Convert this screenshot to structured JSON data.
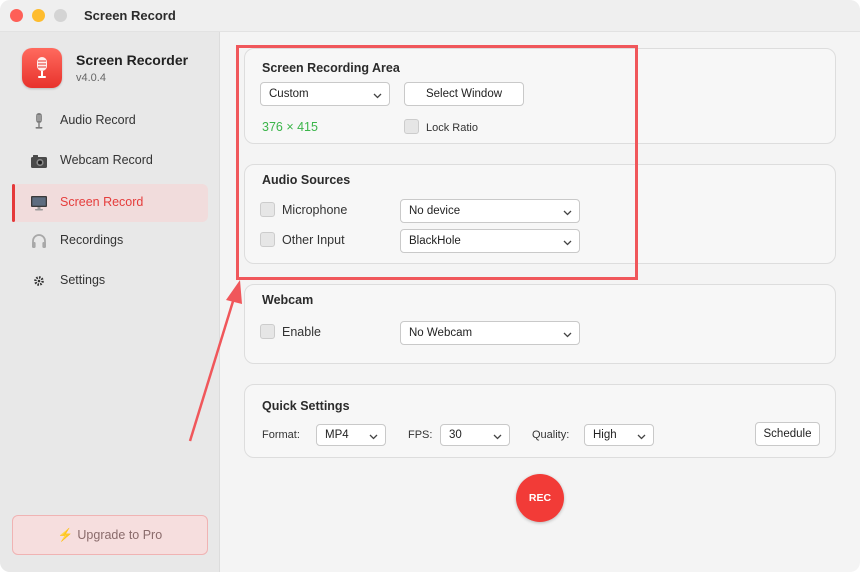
{
  "window": {
    "title": "Screen Record"
  },
  "app": {
    "name": "Screen Recorder",
    "version": "v4.0.4"
  },
  "sidebar": {
    "items": [
      {
        "label": "Audio Record",
        "icon": "microphone-icon"
      },
      {
        "label": "Webcam Record",
        "icon": "webcam-icon"
      },
      {
        "label": "Screen Record",
        "icon": "monitor-icon",
        "active": true
      },
      {
        "label": "Recordings",
        "icon": "headphones-icon"
      },
      {
        "label": "Settings",
        "icon": "gear-icon"
      }
    ],
    "upgrade_label": "Upgrade to Pro"
  },
  "recording_area": {
    "title": "Screen Recording Area",
    "mode_value": "Custom",
    "select_window_label": "Select Window",
    "dimensions": "376 × 415",
    "lock_ratio_label": "Lock Ratio",
    "lock_ratio_checked": false
  },
  "audio_sources": {
    "title": "Audio Sources",
    "microphone_label": "Microphone",
    "microphone_device": "No device",
    "other_input_label": "Other Input",
    "other_input_device": "BlackHole"
  },
  "webcam": {
    "title": "Webcam",
    "enable_label": "Enable",
    "device": "No Webcam"
  },
  "quick_settings": {
    "title": "Quick Settings",
    "format_label": "Format:",
    "format_value": "MP4",
    "fps_label": "FPS:",
    "fps_value": "30",
    "quality_label": "Quality:",
    "quality_value": "High",
    "schedule_label": "Schedule"
  },
  "rec_label": "REC",
  "colors": {
    "accent": "#e5393a",
    "rec": "#f23b37",
    "dimensions_text": "#3bb54a",
    "annotation": "#f0575b"
  }
}
